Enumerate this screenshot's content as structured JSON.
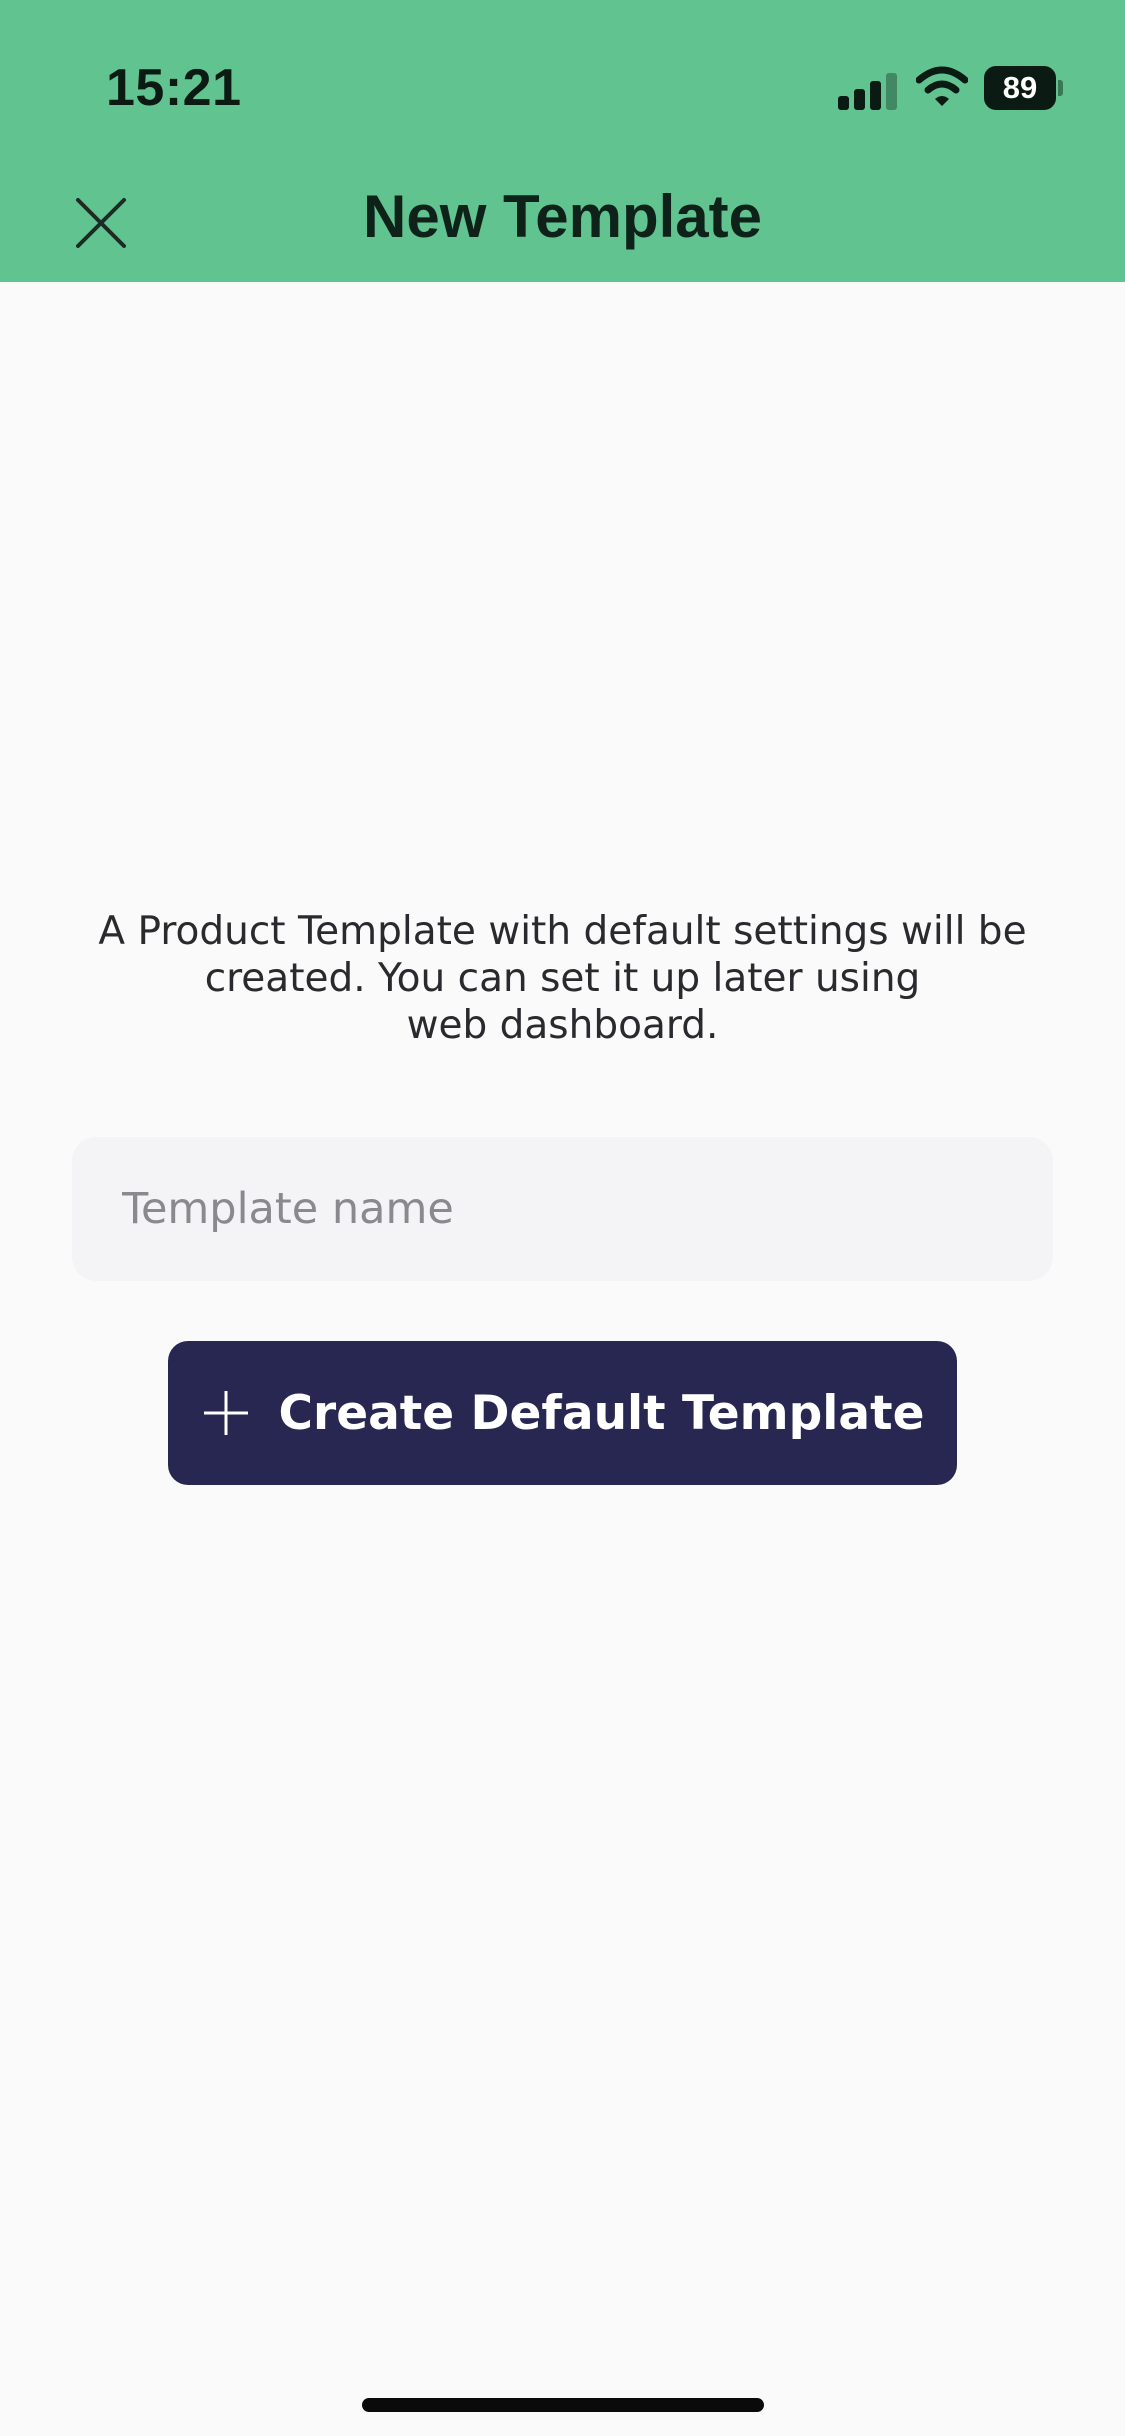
{
  "status_bar": {
    "time": "15:21",
    "battery_level": "89",
    "signal_bars_active": 3,
    "signal_bars_total": 4,
    "icons": [
      "signal-icon",
      "wifi-icon",
      "battery-icon"
    ]
  },
  "header": {
    "title": "New Template",
    "close_icon": "close-icon"
  },
  "main": {
    "info_lines": [
      "A Product Template with default settings will be",
      "created. You can set it up later using",
      "web dashboard."
    ],
    "template_name_placeholder": "Template name",
    "template_name_value": "",
    "create_button_label": "Create Default Template",
    "create_button_icon": "plus-icon"
  },
  "colors": {
    "header_background": "#60c390",
    "page_background": "#fafafb",
    "button_background": "#282752",
    "input_background": "#f4f4f6",
    "placeholder_text": "#8a8a8e"
  }
}
